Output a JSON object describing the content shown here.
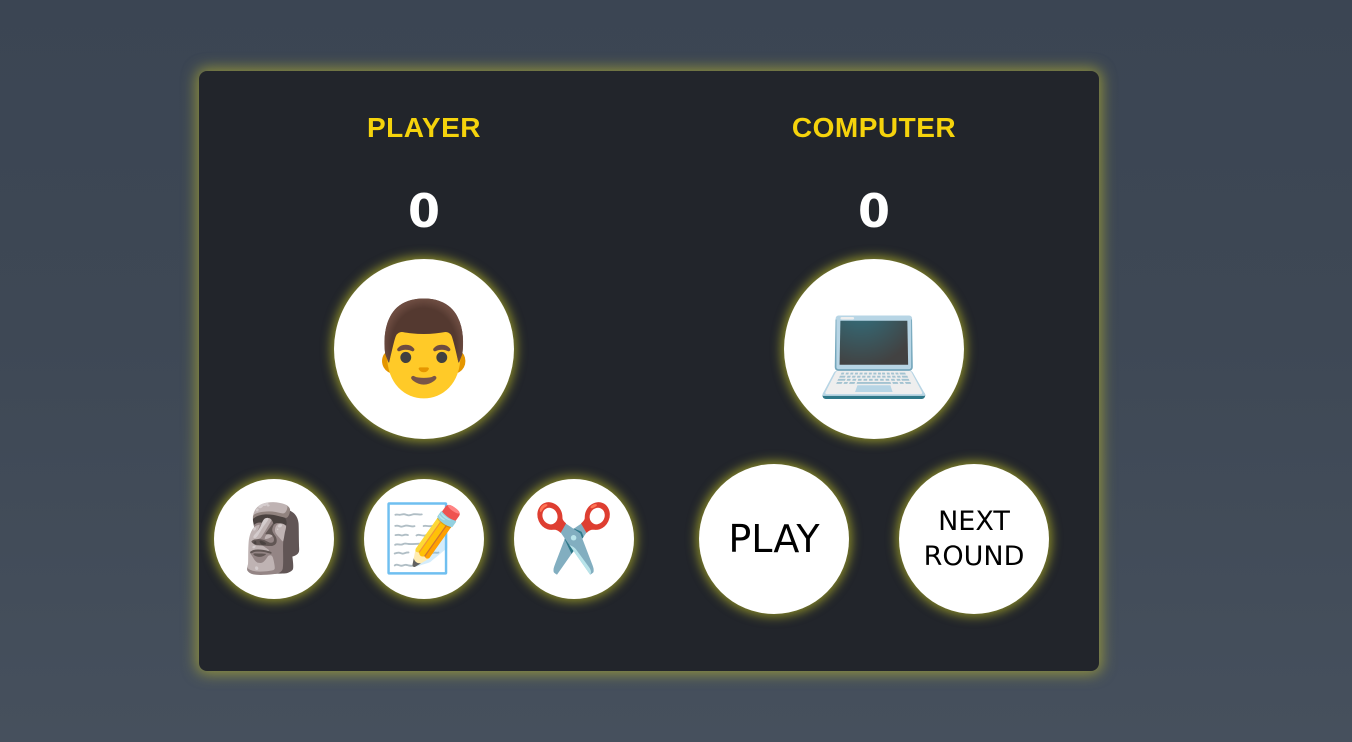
{
  "player": {
    "title": "PLAYER",
    "score": "0",
    "avatar": "👨"
  },
  "computer": {
    "title": "COMPUTER",
    "score": "0",
    "avatar": "💻"
  },
  "choices": {
    "rock": "🗿",
    "paper": "📝",
    "scissors": "✂️"
  },
  "actions": {
    "play_label": "PLAY",
    "next_round_label": "NEXT ROUND"
  },
  "colors": {
    "accent": "#f5d30c",
    "card_bg": "#22252b",
    "glow": "#cdc828"
  },
  "icons": {
    "rock": "moai-icon",
    "paper": "memo-icon",
    "scissors": "scissors-icon",
    "player_avatar": "man-icon",
    "computer_avatar": "laptop-icon"
  }
}
